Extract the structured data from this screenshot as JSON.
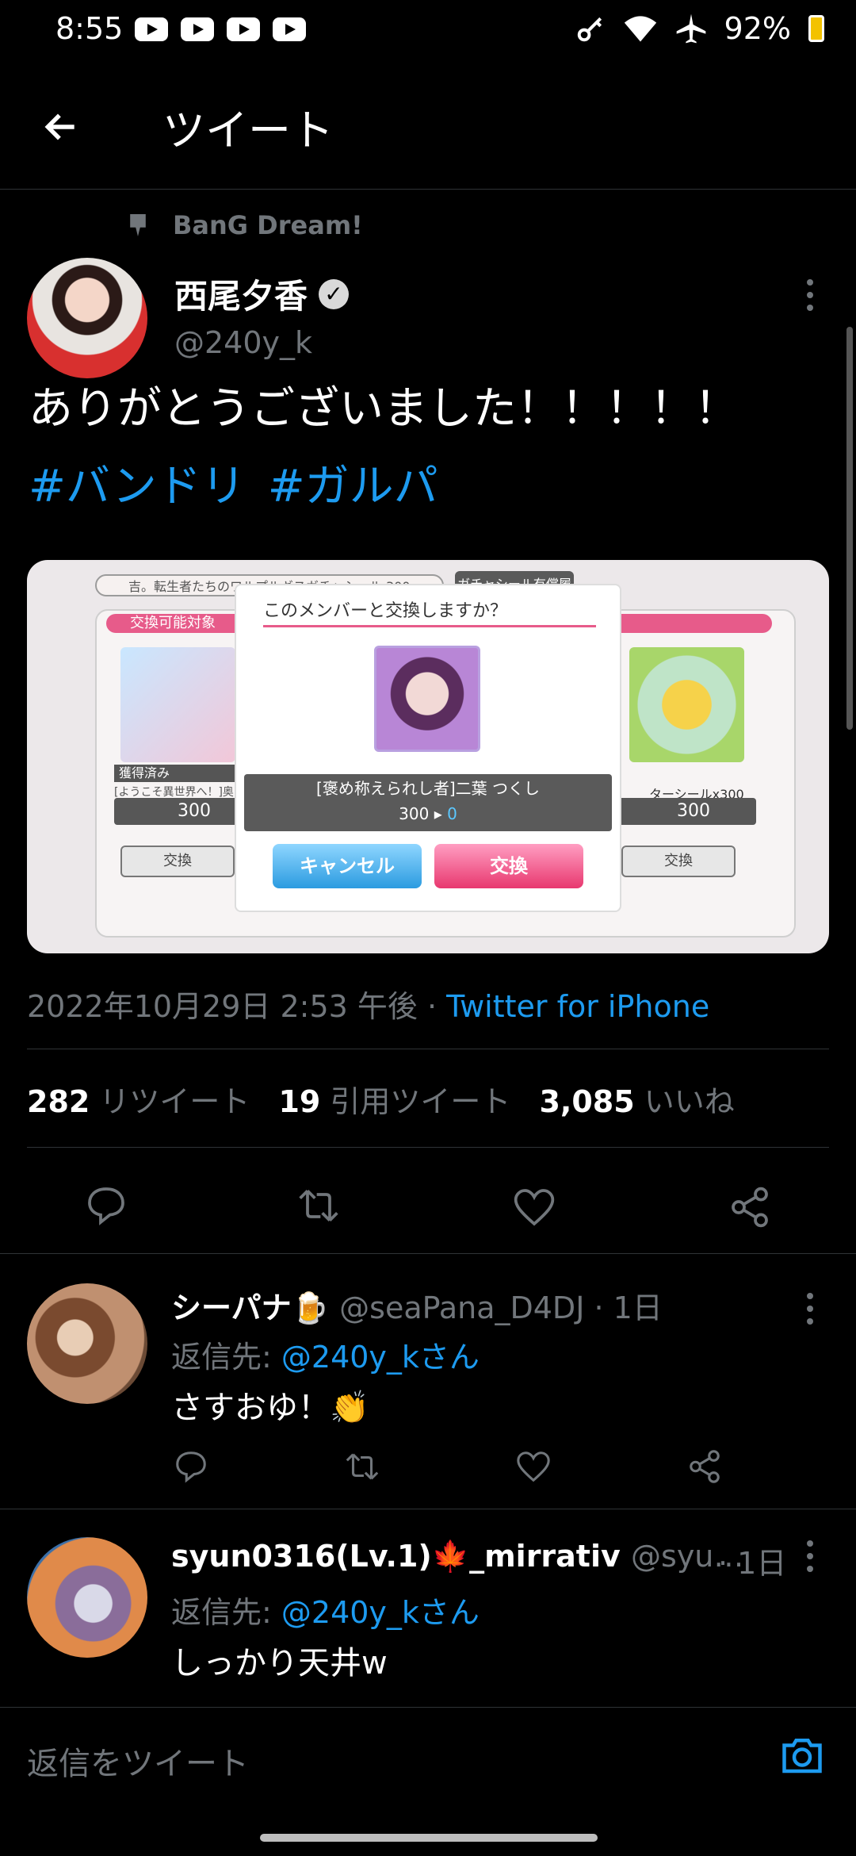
{
  "status_bar": {
    "time": "8:55",
    "battery": "92%"
  },
  "header": {
    "title": "ツイート"
  },
  "tweet": {
    "context": "BanG Dream!",
    "author_name": "西尾夕香",
    "author_handle": "@240y_k",
    "text": "ありがとうございました！！！！！",
    "hashtags": [
      "#バンドリ",
      "#ガルパ"
    ],
    "timestamp": "2022年10月29日 2:53 午後 · ",
    "source": "Twitter for iPhone",
    "stats": {
      "retweets_count": "282",
      "retweets_label": "リツイート",
      "quotes_count": "19",
      "quotes_label": "引用ツイート",
      "likes_count": "3,085",
      "likes_label": "いいね"
    }
  },
  "media": {
    "top_bar_text": "吉。転生者たちのワルプルギスガチャシール",
    "top_bar_value": "300",
    "top_button": "ガチャシール有償履",
    "ribbon": "交換可能対象",
    "left_status": "獲得済み",
    "left_caption": "[ようこそ異世界へ！]奥田 まし",
    "left_cost": "300",
    "left_button": "交換",
    "right_caption": "ターシールx300",
    "right_cost": "300",
    "right_button": "交換",
    "dialog_title": "このメンバーと交換しますか？",
    "dialog_member": "[褒め称えられし者]二葉 つくし",
    "dialog_cost": "300",
    "dialog_remaining": "0",
    "dialog_cancel": "キャンセル",
    "dialog_confirm": "交換"
  },
  "replies": [
    {
      "name": "シーパナ🍺",
      "handle": "@seaPana_D4DJ · 1日",
      "reply_prefix": "返信先: ",
      "reply_to": "@240y_kさん",
      "text": "さすおゆ！👏"
    },
    {
      "name": "syun0316(Lv.1)🍁_mirrativ",
      "handle": "@syu…",
      "time": "· 1日",
      "reply_prefix": "返信先: ",
      "reply_to": "@240y_kさん",
      "text": "しっかり天井w"
    }
  ],
  "reply_bar": {
    "placeholder": "返信をツイート"
  },
  "colors": {
    "accent": "#1d9bf0",
    "background": "#000000",
    "muted": "#71767b"
  }
}
